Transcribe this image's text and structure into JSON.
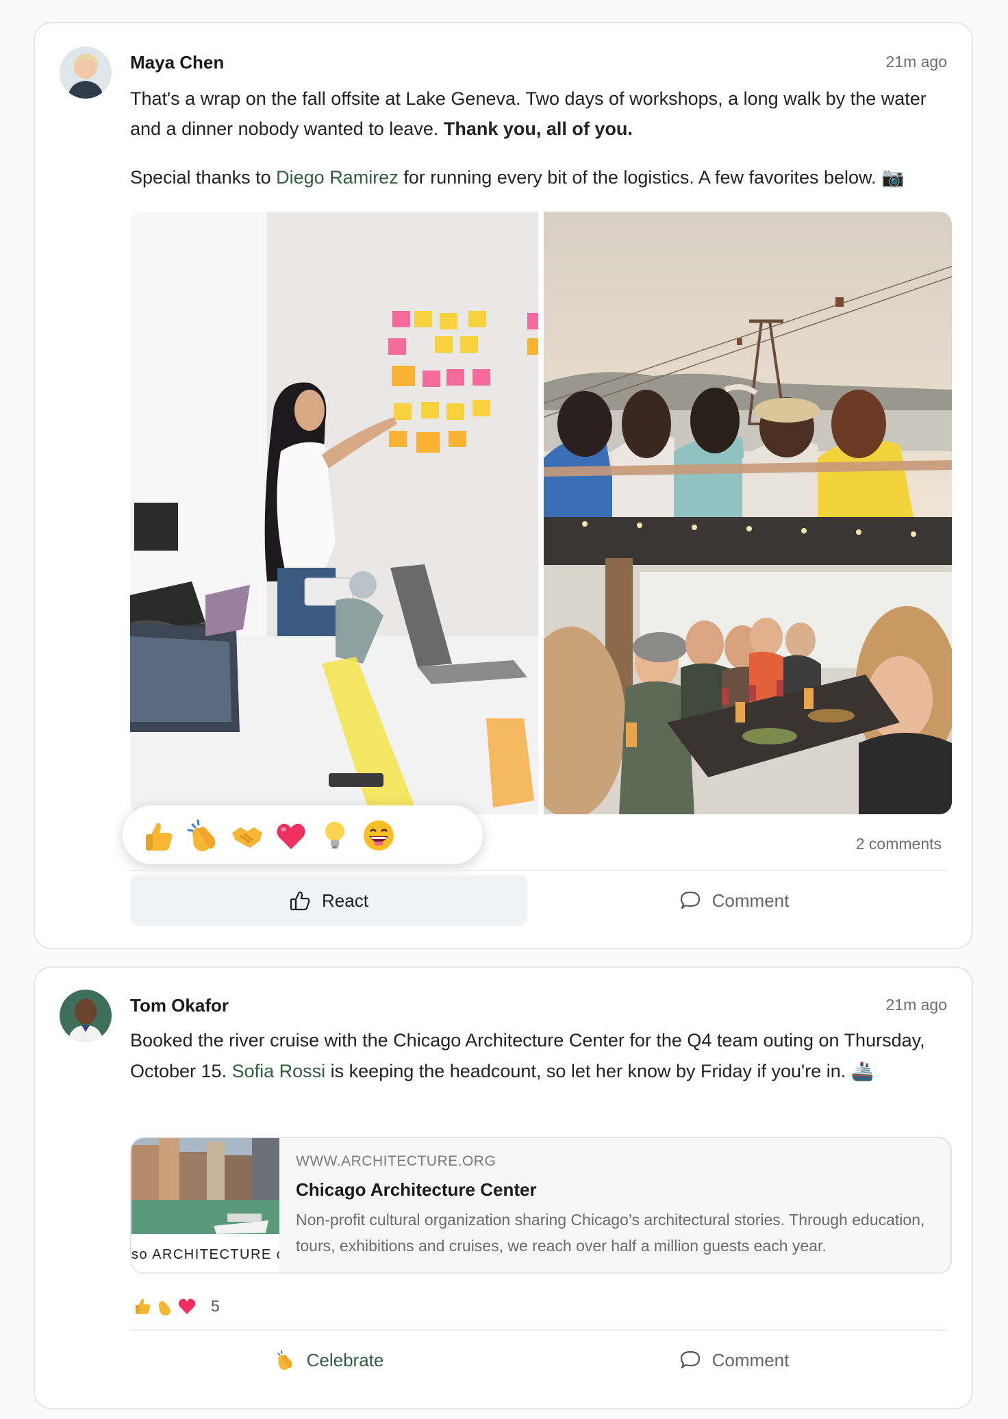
{
  "posts": [
    {
      "author": "Maya Chen",
      "time": "21m ago",
      "text_line1": "That's a wrap on the fall offsite at Lake Geneva. Two days of workshops, a long walk by the water and a dinner nobody wanted to leave. ",
      "text_bold": "Thank you, all of you.",
      "text2_before": "Special thanks to ",
      "mention": "Diego Ramirez",
      "text2_after": " for running every bit of the logistics. A few favorites below. 📷",
      "comments_count": "2 comments",
      "react_label": "React",
      "comment_label": "Comment",
      "reaction_options": [
        "like",
        "clap",
        "support",
        "love",
        "insightful",
        "funny"
      ]
    },
    {
      "author": "Tom Okafor",
      "time": "21m ago",
      "text_before": "Booked the river cruise with the Chicago Architecture Center for the Q4 team outing on Thursday, October 15. ",
      "mention": "Sofia Rossi",
      "text_after": " is keeping the headcount, so let her know by Friday if you're in. 🚢",
      "link_preview": {
        "domain": "WWW.ARCHITECTURE.ORG",
        "title": "Chicago Architecture Center",
        "description": "Non-profit cultural organization sharing Chicago’s architectural stories. Through education, tours, exhibitions and cruises, we reach over half a million guests each year.",
        "thumb_caption": "so ARCHITECTURE c"
      },
      "reaction_count": "5",
      "celebrate_label": "Celebrate",
      "comment_label": "Comment"
    }
  ],
  "colors": {
    "mention": "#2e5e3e",
    "muted": "#6e6e6e",
    "card_border": "#e6e6e6"
  }
}
